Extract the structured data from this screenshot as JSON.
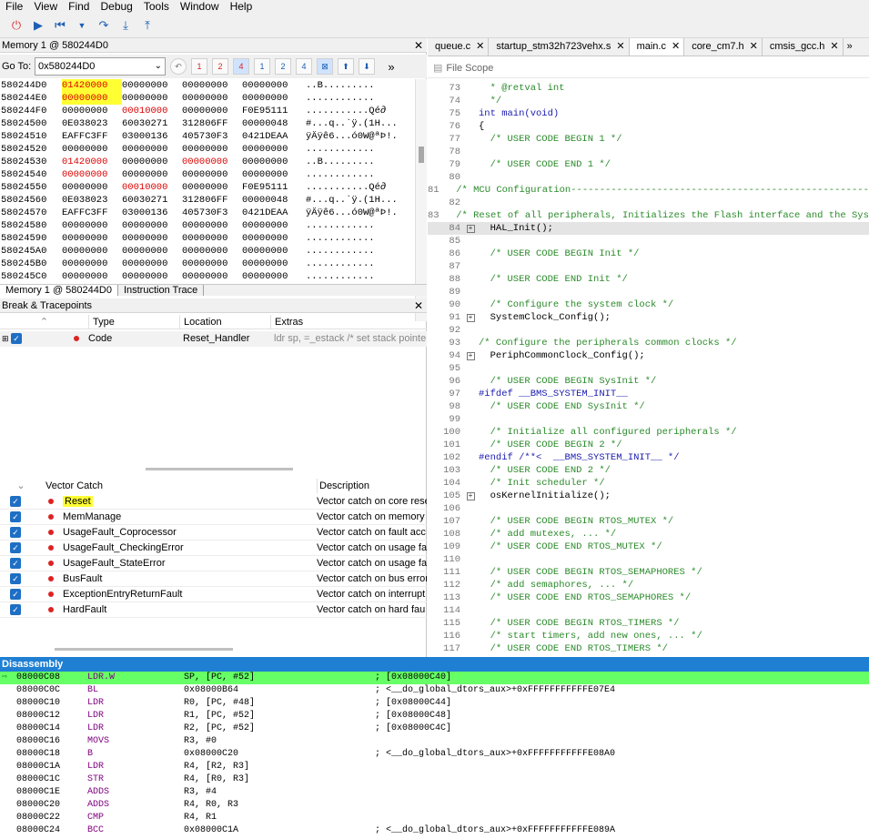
{
  "menu": [
    "File",
    "View",
    "Find",
    "Debug",
    "Tools",
    "Window",
    "Help"
  ],
  "memory": {
    "title": "Memory 1 @ 580244D0",
    "goto_label": "Go To:",
    "goto_value": "0x580244D0",
    "rows": [
      {
        "addr": "580244D0",
        "c": [
          "01420000",
          "00000000",
          "00000000",
          "00000000"
        ],
        "ascii": "..B.........",
        "red": [
          0
        ]
      },
      {
        "addr": "580244E0",
        "c": [
          "00000000",
          "00000000",
          "00000000",
          "00000000"
        ],
        "ascii": "............",
        "red": [
          0
        ]
      },
      {
        "addr": "580244F0",
        "c": [
          "00000000",
          "00010000",
          "00000000",
          "F0E95111"
        ],
        "ascii": "...........Qé∂",
        "red": [
          1
        ]
      },
      {
        "addr": "58024500",
        "c": [
          "0E038023",
          "60030271",
          "312806FF",
          "00000048"
        ],
        "ascii": "#...q..`ÿ.(1H...",
        "red": []
      },
      {
        "addr": "58024510",
        "c": [
          "EAFFC3FF",
          "03000136",
          "405730F3",
          "0421DEAA"
        ],
        "ascii": "ÿÄÿê6...ó0W@ªÞ!.",
        "red": []
      },
      {
        "addr": "58024520",
        "c": [
          "00000000",
          "00000000",
          "00000000",
          "00000000"
        ],
        "ascii": "............",
        "red": []
      },
      {
        "addr": "58024530",
        "c": [
          "01420000",
          "00000000",
          "00000000",
          "00000000"
        ],
        "ascii": "..B.........",
        "red": [
          0,
          2
        ]
      },
      {
        "addr": "58024540",
        "c": [
          "00000000",
          "00000000",
          "00000000",
          "00000000"
        ],
        "ascii": "............",
        "red": [
          0
        ]
      },
      {
        "addr": "58024550",
        "c": [
          "00000000",
          "00010000",
          "00000000",
          "F0E95111"
        ],
        "ascii": "...........Qé∂",
        "red": [
          1
        ]
      },
      {
        "addr": "58024560",
        "c": [
          "0E038023",
          "60030271",
          "312806FF",
          "00000048"
        ],
        "ascii": "#...q..`ÿ.(1H...",
        "red": []
      },
      {
        "addr": "58024570",
        "c": [
          "EAFFC3FF",
          "03000136",
          "405730F3",
          "0421DEAA"
        ],
        "ascii": "ÿÄÿê6...ó0W@ªÞ!.",
        "red": []
      },
      {
        "addr": "58024580",
        "c": [
          "00000000",
          "00000000",
          "00000000",
          "00000000"
        ],
        "ascii": "............",
        "red": []
      },
      {
        "addr": "58024590",
        "c": [
          "00000000",
          "00000000",
          "00000000",
          "00000000"
        ],
        "ascii": "............",
        "red": []
      },
      {
        "addr": "580245A0",
        "c": [
          "00000000",
          "00000000",
          "00000000",
          "00000000"
        ],
        "ascii": "............",
        "red": []
      },
      {
        "addr": "580245B0",
        "c": [
          "00000000",
          "00000000",
          "00000000",
          "00000000"
        ],
        "ascii": "............",
        "red": []
      },
      {
        "addr": "580245C0",
        "c": [
          "00000000",
          "00000000",
          "00000000",
          "00000000"
        ],
        "ascii": "............",
        "red": []
      }
    ],
    "tabs": [
      "Memory 1 @ 580244D0",
      "Instruction Trace"
    ]
  },
  "breakpoints": {
    "title": "Break & Tracepoints",
    "columns": [
      "Type",
      "Location",
      "Extras"
    ],
    "row": {
      "type": "Code",
      "location": "Reset_Handler",
      "extras": "ldr sp, =_estack /* set stack pointe"
    }
  },
  "vector_catch": {
    "columns": [
      "Vector Catch",
      "Description"
    ],
    "rows": [
      {
        "name": "Reset",
        "desc": "Vector catch on core rese"
      },
      {
        "name": "MemManage",
        "desc": "Vector catch on memory"
      },
      {
        "name": "UsageFault_Coprocessor",
        "desc": "Vector catch on fault acc"
      },
      {
        "name": "UsageFault_CheckingError",
        "desc": "Vector catch on usage fa"
      },
      {
        "name": "UsageFault_StateError",
        "desc": "Vector catch on usage fa"
      },
      {
        "name": "BusFault",
        "desc": "Vector catch on bus error"
      },
      {
        "name": "ExceptionEntryReturnFault",
        "desc": "Vector catch on interrupt"
      },
      {
        "name": "HardFault",
        "desc": "Vector catch on hard fau"
      }
    ]
  },
  "editor": {
    "tabs": [
      "queue.c",
      "startup_stm32h723vehx.s",
      "main.c",
      "core_cm7.h",
      "cmsis_gcc.h"
    ],
    "scope": "File Scope",
    "lines": [
      {
        "n": "73",
        "t": "  * @retval int",
        "k": "cm"
      },
      {
        "n": "74",
        "t": "  */",
        "k": "cm"
      },
      {
        "n": "75",
        "t": "int main(void)",
        "k": "kw"
      },
      {
        "n": "76",
        "t": "{",
        "k": ""
      },
      {
        "n": "77",
        "t": "  /* USER CODE BEGIN 1 */",
        "k": "cm"
      },
      {
        "n": "78",
        "t": "",
        "k": ""
      },
      {
        "n": "79",
        "t": "  /* USER CODE END 1 */",
        "k": "cm"
      },
      {
        "n": "80",
        "t": "",
        "k": ""
      },
      {
        "n": "81",
        "t": "  /* MCU Configuration--------------------------------------------------------",
        "k": "cm"
      },
      {
        "n": "82",
        "t": "",
        "k": ""
      },
      {
        "n": "83",
        "t": "  /* Reset of all peripherals, Initializes the Flash interface and the Systick. */",
        "k": "cm"
      },
      {
        "n": "84",
        "t": "  HAL_Init();",
        "k": "",
        "plus": true,
        "cur": true,
        "dot": true
      },
      {
        "n": "85",
        "t": "",
        "k": ""
      },
      {
        "n": "86",
        "t": "  /* USER CODE BEGIN Init */",
        "k": "cm"
      },
      {
        "n": "87",
        "t": "",
        "k": ""
      },
      {
        "n": "88",
        "t": "  /* USER CODE END Init */",
        "k": "cm"
      },
      {
        "n": "89",
        "t": "",
        "k": ""
      },
      {
        "n": "90",
        "t": "  /* Configure the system clock */",
        "k": "cm"
      },
      {
        "n": "91",
        "t": "  SystemClock_Config();",
        "k": "",
        "plus": true,
        "dot": true
      },
      {
        "n": "92",
        "t": "",
        "k": ""
      },
      {
        "n": "93",
        "t": "/* Configure the peripherals common clocks */",
        "k": "cm"
      },
      {
        "n": "94",
        "t": "  PeriphCommonClock_Config();",
        "k": "",
        "plus": true,
        "dot": true
      },
      {
        "n": "95",
        "t": "",
        "k": ""
      },
      {
        "n": "96",
        "t": "  /* USER CODE BEGIN SysInit */",
        "k": "cm"
      },
      {
        "n": "97",
        "t": "#ifdef __BMS_SYSTEM_INIT__",
        "k": "kw"
      },
      {
        "n": "98",
        "t": "  /* USER CODE END SysInit */",
        "k": "cm"
      },
      {
        "n": "99",
        "t": "",
        "k": ""
      },
      {
        "n": "100",
        "t": "  /* Initialize all configured peripherals */",
        "k": "cm"
      },
      {
        "n": "101",
        "t": "  /* USER CODE BEGIN 2 */",
        "k": "cm"
      },
      {
        "n": "102",
        "t": "#endif /**<  __BMS_SYSTEM_INIT__ */",
        "k": "kw"
      },
      {
        "n": "103",
        "t": "  /* USER CODE END 2 */",
        "k": "cm"
      },
      {
        "n": "104",
        "t": "  /* Init scheduler */",
        "k": "cm"
      },
      {
        "n": "105",
        "t": "  osKernelInitialize();",
        "k": "",
        "plus": true,
        "dot": true
      },
      {
        "n": "106",
        "t": "",
        "k": ""
      },
      {
        "n": "107",
        "t": "  /* USER CODE BEGIN RTOS_MUTEX */",
        "k": "cm"
      },
      {
        "n": "108",
        "t": "  /* add mutexes, ... */",
        "k": "cm"
      },
      {
        "n": "109",
        "t": "  /* USER CODE END RTOS_MUTEX */",
        "k": "cm"
      },
      {
        "n": "110",
        "t": "",
        "k": ""
      },
      {
        "n": "111",
        "t": "  /* USER CODE BEGIN RTOS_SEMAPHORES */",
        "k": "cm"
      },
      {
        "n": "112",
        "t": "  /* add semaphores, ... */",
        "k": "cm"
      },
      {
        "n": "113",
        "t": "  /* USER CODE END RTOS_SEMAPHORES */",
        "k": "cm"
      },
      {
        "n": "114",
        "t": "",
        "k": ""
      },
      {
        "n": "115",
        "t": "  /* USER CODE BEGIN RTOS_TIMERS */",
        "k": "cm"
      },
      {
        "n": "116",
        "t": "  /* start timers, add new ones, ... */",
        "k": "cm"
      },
      {
        "n": "117",
        "t": "  /* USER CODE END RTOS_TIMERS */",
        "k": "cm"
      }
    ]
  },
  "disassembly": {
    "title": "Disassembly",
    "rows": [
      {
        "addr": "08000C08",
        "op": "LDR.W",
        "args": "SP, [PC, #52]",
        "cmt": "; [0x08000C40]",
        "cur": true
      },
      {
        "addr": "08000C0C",
        "op": "BL",
        "args": "0x08000B64",
        "cmt": "; <__do_global_dtors_aux>+0xFFFFFFFFFFFE07E4"
      },
      {
        "addr": "08000C10",
        "op": "LDR",
        "args": "R0, [PC, #48]",
        "cmt": "; [0x08000C44]"
      },
      {
        "addr": "08000C12",
        "op": "LDR",
        "args": "R1, [PC, #52]",
        "cmt": "; [0x08000C48]"
      },
      {
        "addr": "08000C14",
        "op": "LDR",
        "args": "R2, [PC, #52]",
        "cmt": "; [0x08000C4C]"
      },
      {
        "addr": "08000C16",
        "op": "MOVS",
        "args": "R3, #0",
        "cmt": ""
      },
      {
        "addr": "08000C18",
        "op": "B",
        "args": "0x08000C20",
        "cmt": "; <__do_global_dtors_aux>+0xFFFFFFFFFFFE08A0"
      },
      {
        "addr": "08000C1A",
        "op": "LDR",
        "args": "R4, [R2, R3]",
        "cmt": ""
      },
      {
        "addr": "08000C1C",
        "op": "STR",
        "args": "R4, [R0, R3]",
        "cmt": ""
      },
      {
        "addr": "08000C1E",
        "op": "ADDS",
        "args": "R3, #4",
        "cmt": ""
      },
      {
        "addr": "08000C20",
        "op": "ADDS",
        "args": "R4, R0, R3",
        "cmt": ""
      },
      {
        "addr": "08000C22",
        "op": "CMP",
        "args": "R4, R1",
        "cmt": ""
      },
      {
        "addr": "08000C24",
        "op": "BCC",
        "args": "0x08000C1A",
        "cmt": "; <__do_global_dtors_aux>+0xFFFFFFFFFFFE089A"
      }
    ]
  },
  "colors": {
    "highlight": "#ffff33",
    "accent": "#1f7fd3",
    "current_line": "#66ff66"
  }
}
